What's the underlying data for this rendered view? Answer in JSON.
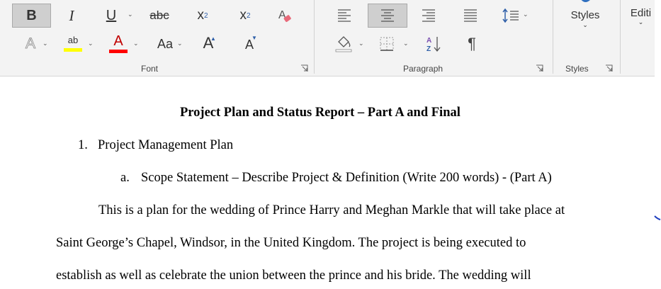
{
  "ribbon": {
    "font_group": {
      "label": "Font",
      "bold": "B",
      "italic": "I",
      "underline": "U",
      "strikethrough": "abc",
      "subscript_base": "x",
      "subscript_mark": "2",
      "superscript_base": "x",
      "superscript_mark": "2",
      "text_effects": "A",
      "highlight": "ab",
      "font_color": "A",
      "change_case": "Aa",
      "grow_font": "A",
      "shrink_font": "A",
      "highlight_color": "#ffff00",
      "font_color_value": "#ff0000"
    },
    "paragraph_group": {
      "label": "Paragraph",
      "pilcrow": "¶"
    },
    "styles_group": {
      "label": "Styles",
      "button_label": "Styles"
    },
    "editing_group": {
      "button_label": "Editi"
    }
  },
  "document": {
    "title": "Project Plan and Status Report – Part A and Final",
    "list_item_1_number": "1.",
    "list_item_1_text": "Project Management Plan",
    "list_item_a_letter": "a.",
    "list_item_a_text": "Scope Statement – Describe Project & Definition (Write 200 words) - (Part A)",
    "paragraph_lines": [
      "This is a plan for the wedding of Prince Harry and Meghan Markle that will take place at",
      "Saint George’s Chapel, Windsor, in the United Kingdom.  The project is being executed to",
      "establish as well as celebrate the union between the prince and his bride. The wedding will"
    ]
  }
}
